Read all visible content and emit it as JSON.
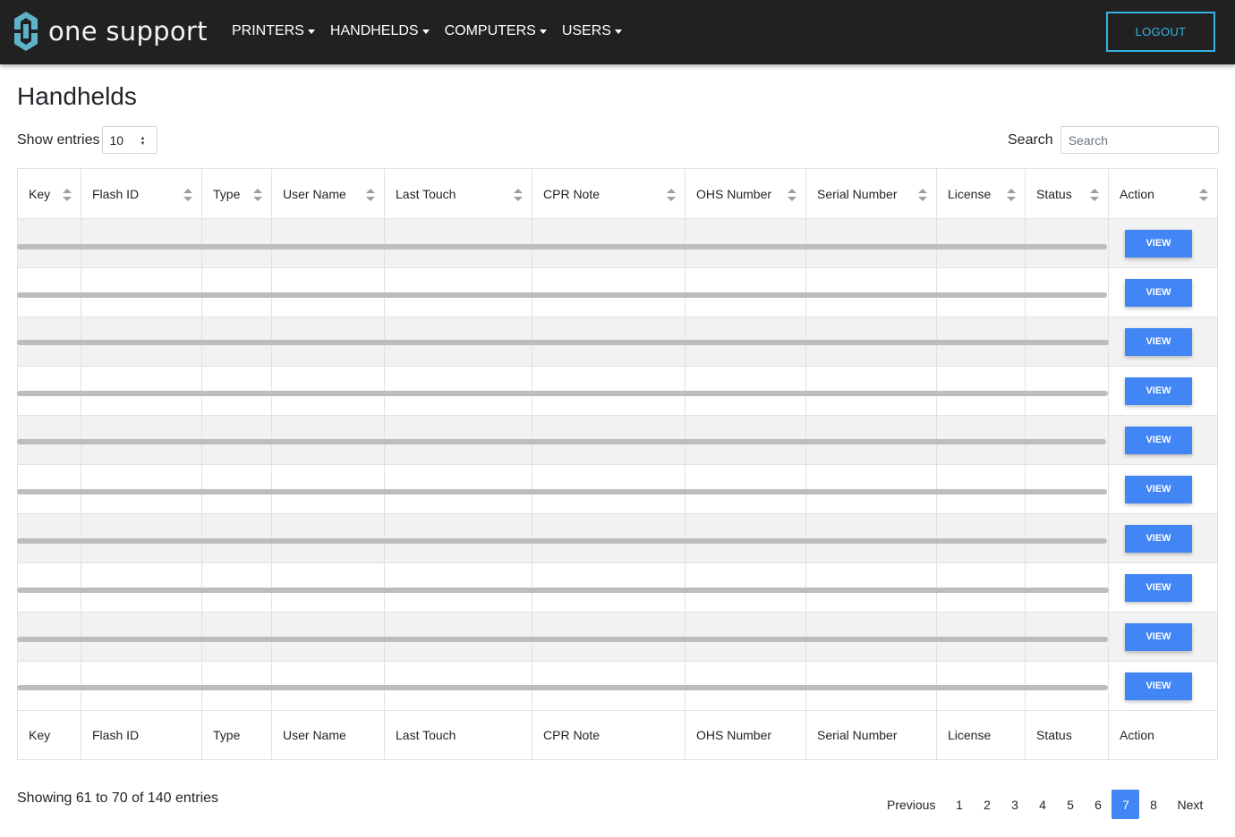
{
  "brand": {
    "name": "one support",
    "logo_icon": "one-support-logo-icon"
  },
  "nav": {
    "items": [
      {
        "label": "PRINTERS"
      },
      {
        "label": "HANDHELDS"
      },
      {
        "label": "COMPUTERS"
      },
      {
        "label": "USERS"
      }
    ],
    "logout_label": "LOGOUT"
  },
  "page": {
    "title": "Handhelds"
  },
  "controls": {
    "show_entries_label": "Show entries",
    "entries_value": "10",
    "search_label": "Search",
    "search_placeholder": "Search"
  },
  "table": {
    "columns": [
      "Key",
      "Flash ID",
      "Type",
      "User Name",
      "Last Touch",
      "CPR Note",
      "OHS Number",
      "Serial Number",
      "License",
      "Status",
      "Action"
    ],
    "rows": [
      {
        "cells": [
          "",
          "",
          "",
          "",
          "",
          "",
          "",
          "",
          "",
          ""
        ],
        "action": "VIEW"
      },
      {
        "cells": [
          "",
          "",
          "",
          "",
          "",
          "",
          "",
          "",
          "",
          ""
        ],
        "action": "VIEW"
      },
      {
        "cells": [
          "",
          "",
          "",
          "",
          "",
          "",
          "",
          "",
          "",
          ""
        ],
        "action": "VIEW"
      },
      {
        "cells": [
          "",
          "",
          "",
          "",
          "",
          "",
          "",
          "",
          "",
          ""
        ],
        "action": "VIEW"
      },
      {
        "cells": [
          "",
          "",
          "",
          "",
          "",
          "",
          "",
          "",
          "",
          ""
        ],
        "action": "VIEW"
      },
      {
        "cells": [
          "",
          "",
          "",
          "",
          "",
          "",
          "",
          "",
          "",
          ""
        ],
        "action": "VIEW"
      },
      {
        "cells": [
          "",
          "",
          "",
          "",
          "",
          "",
          "",
          "",
          "",
          ""
        ],
        "action": "VIEW"
      },
      {
        "cells": [
          "",
          "",
          "",
          "",
          "",
          "",
          "",
          "",
          "",
          ""
        ],
        "action": "VIEW"
      },
      {
        "cells": [
          "",
          "",
          "",
          "",
          "",
          "",
          "",
          "",
          "",
          ""
        ],
        "action": "VIEW"
      },
      {
        "cells": [
          "",
          "",
          "",
          "",
          "",
          "",
          "",
          "",
          "",
          ""
        ],
        "action": "VIEW"
      }
    ]
  },
  "footer": {
    "info": "Showing 61 to 70 of 140 entries",
    "pagination": {
      "previous": "Previous",
      "pages": [
        "1",
        "2",
        "3",
        "4",
        "5",
        "6",
        "7",
        "8"
      ],
      "active": "7",
      "next": "Next"
    }
  },
  "colors": {
    "navbar_bg": "#212121",
    "accent": "#33b5e5",
    "button_primary": "#4285f4",
    "row_stripe": "#f2f2f2"
  }
}
